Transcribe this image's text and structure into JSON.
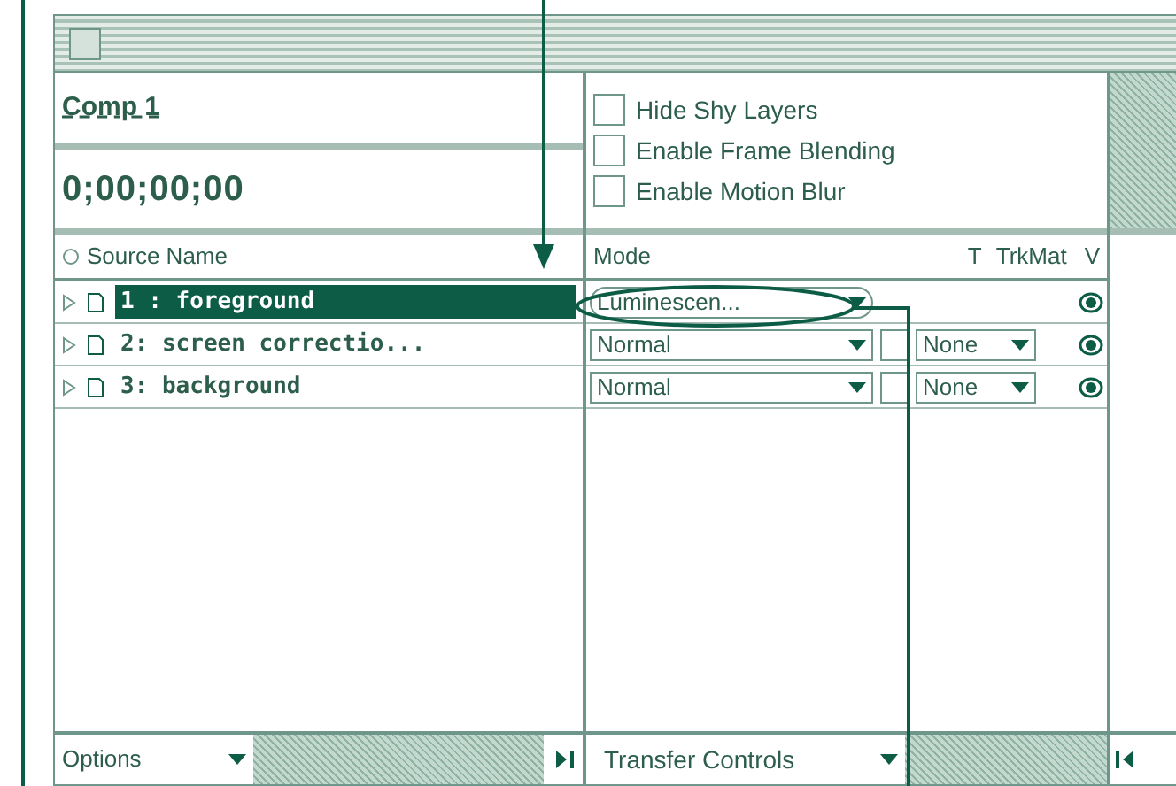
{
  "comp": {
    "name": "Comp 1",
    "time": "0;00;00;00"
  },
  "options": [
    {
      "label": "Hide Shy Layers",
      "checked": false
    },
    {
      "label": "Enable Frame Blending",
      "checked": false
    },
    {
      "label": "Enable Motion Blur",
      "checked": false
    }
  ],
  "columns": {
    "source": "Source Name",
    "mode": "Mode",
    "t": "T",
    "trkmat": "TrkMat",
    "v": "V"
  },
  "layers": [
    {
      "name": "1 : foreground",
      "selected": true,
      "mode": "Luminescen..."
    },
    {
      "name": "2: screen correctio...",
      "selected": false,
      "mode": "Normal",
      "t": false,
      "trkmat": "None"
    },
    {
      "name": "3: background",
      "selected": false,
      "mode": "Normal",
      "t": false,
      "trkmat": "None"
    }
  ],
  "bottom": {
    "options": "Options",
    "transfer": "Transfer Controls"
  }
}
